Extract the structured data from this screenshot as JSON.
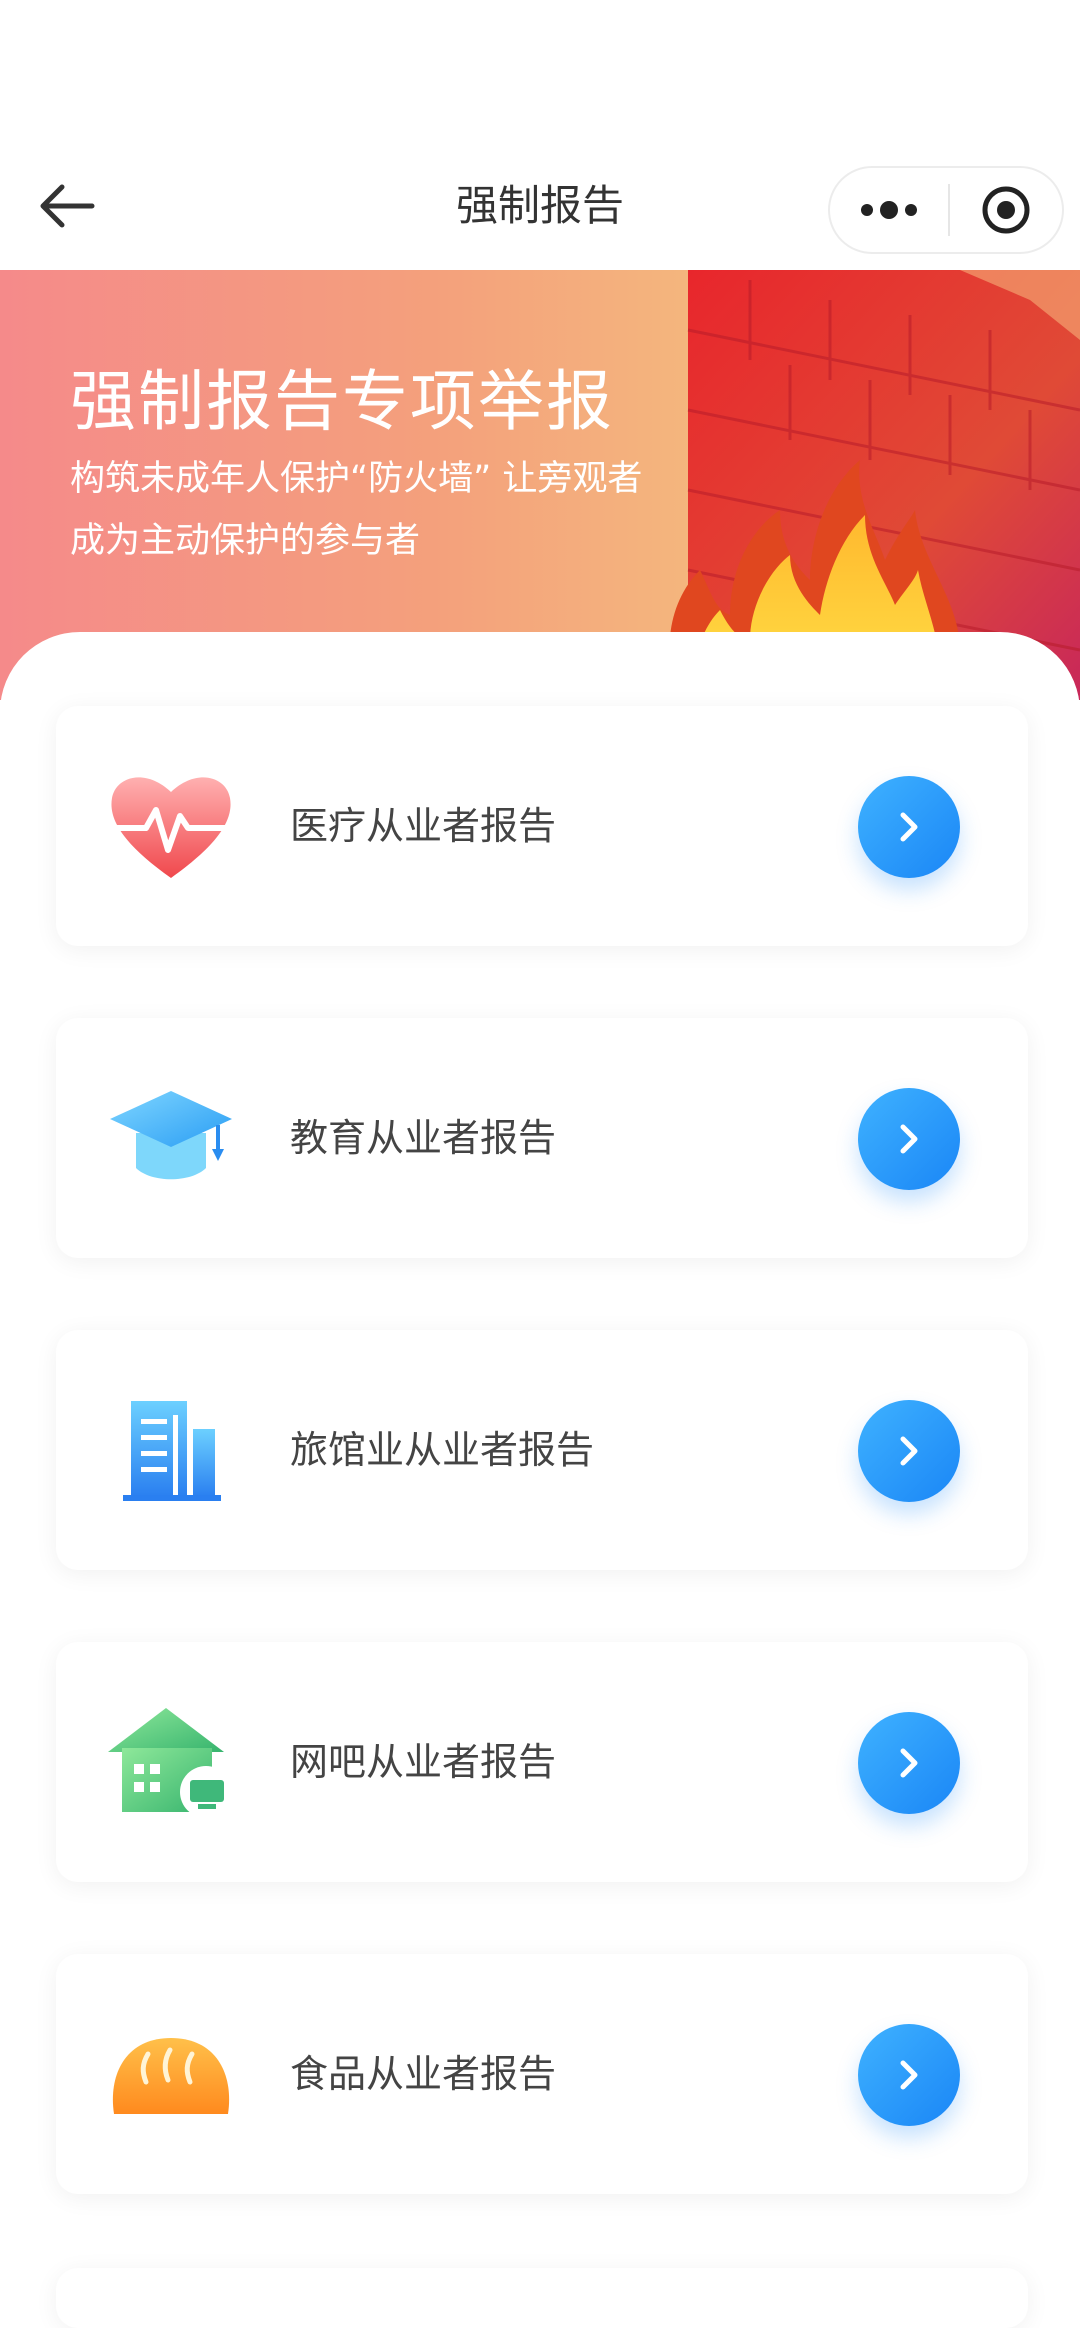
{
  "nav": {
    "title": "强制报告",
    "back_icon": "arrow-left-icon",
    "more_icon": "more-dots-icon",
    "close_icon": "target-circle-icon"
  },
  "banner": {
    "title": "强制报告专项举报",
    "subtitle": "构筑未成年人保护“防火墙” 让旁观者成为主动保护的参与者",
    "colors": {
      "from": "#f58a8a",
      "to": "#f3cf86"
    }
  },
  "reports": [
    {
      "label": "医疗从业者报告",
      "icon": "heart-pulse-icon"
    },
    {
      "label": "教育从业者报告",
      "icon": "graduation-cap-icon"
    },
    {
      "label": "旅馆业从业者报告",
      "icon": "building-icon"
    },
    {
      "label": "网吧从业者报告",
      "icon": "house-computer-icon"
    },
    {
      "label": "食品从业者报告",
      "icon": "bread-icon"
    }
  ],
  "accent": "#1a86f6"
}
